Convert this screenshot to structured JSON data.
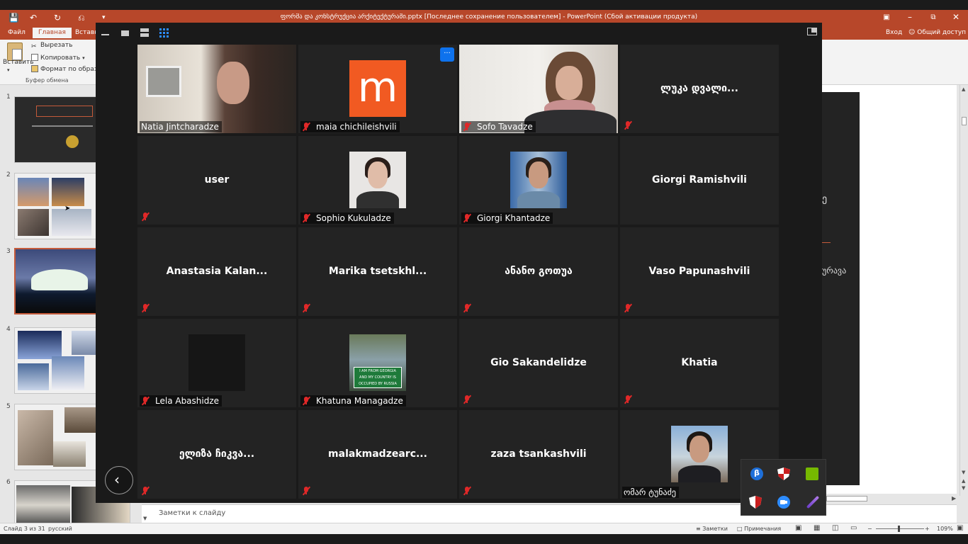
{
  "powerpoint": {
    "title": "ფორმა და კონსტრუქცია არქიტექტურაში.pptx [Последнее сохранение пользователем] - PowerPoint (Сбой активации продукта)",
    "signin": "Вход",
    "share": "Общий доступ",
    "tabs": [
      "Файл",
      "Главная",
      "Вставка"
    ],
    "clipboard": {
      "paste": "Вставить",
      "cut": "Вырезать",
      "copy": "Копировать",
      "format": "Формат по образцу",
      "group": "Буфер обмена"
    },
    "slide_numbers": [
      "1",
      "2",
      "3",
      "4",
      "5",
      "6"
    ],
    "slide_partial_text1": "ე",
    "slide_partial_text2": "ურავა",
    "notes_placeholder": "Заметки к слайду",
    "status": {
      "slide": "Слайд 3 из 31",
      "language": "русский",
      "notes": "Заметки",
      "comments": "Примечания",
      "zoom": "109%"
    }
  },
  "zoom": {
    "participants": [
      {
        "name": "Natia Jintcharadze",
        "display": "video",
        "muted": false
      },
      {
        "name": "maia chichileishvili",
        "display": "avatar-m",
        "muted": true
      },
      {
        "name": "Sofo Tavadze",
        "display": "video",
        "muted": true
      },
      {
        "name": "ლუკა დვალი...",
        "display": "name",
        "muted": true
      },
      {
        "name": "user",
        "display": "name",
        "muted": true
      },
      {
        "name": "Sophio Kukuladze",
        "display": "avatar",
        "muted": true
      },
      {
        "name": "Giorgi Khantadze",
        "display": "avatar",
        "muted": true
      },
      {
        "name": "Giorgi Ramishvili",
        "display": "name",
        "muted": false
      },
      {
        "name": "Anastasia  Kalan...",
        "display": "name",
        "muted": true
      },
      {
        "name": "Marika  tsetskhl...",
        "display": "name",
        "muted": true
      },
      {
        "name": "ანანო გოთუა",
        "display": "name",
        "muted": true
      },
      {
        "name": "Vaso Papunashvili",
        "display": "name",
        "muted": true
      },
      {
        "name": "Lela Abashidze",
        "display": "avatar-dark",
        "muted": true
      },
      {
        "name": "Khatuna Managadze",
        "display": "avatar-sign",
        "muted": true
      },
      {
        "name": "Gio Sakandelidze",
        "display": "name",
        "muted": true
      },
      {
        "name": "Khatia",
        "display": "name",
        "muted": true
      },
      {
        "name": "ელიზა ჩიკვა...",
        "display": "name",
        "muted": true
      },
      {
        "name": "malakmadzearc...",
        "display": "name",
        "muted": true
      },
      {
        "name": "zaza tsankashvili",
        "display": "name",
        "muted": true
      },
      {
        "name": "ომარ ტუნაძე",
        "display": "avatar",
        "muted": false
      }
    ],
    "avatar_letter": "m",
    "sign_text": [
      "I AM FROM GEORGIA",
      "AND MY COUNTRY IS",
      "OCCUPIED BY RUSSIA"
    ],
    "more_button": "···"
  },
  "colors": {
    "ppt_accent": "#b7472a",
    "zoom_bg": "#1a1a1a",
    "tile_bg": "#232323",
    "mute_red": "#e02828",
    "zoom_blue": "#0e72ed",
    "avatar_orange": "#f15a22"
  },
  "icons": [
    "save-icon",
    "undo-icon",
    "redo-icon",
    "minimize-icon",
    "restore-icon",
    "close-icon",
    "grid-view-icon",
    "back-arrow-icon",
    "bluetooth-icon",
    "shield-icon",
    "nvidia-icon",
    "zoom-app-icon",
    "pen-icon",
    "mic-muted-icon"
  ]
}
